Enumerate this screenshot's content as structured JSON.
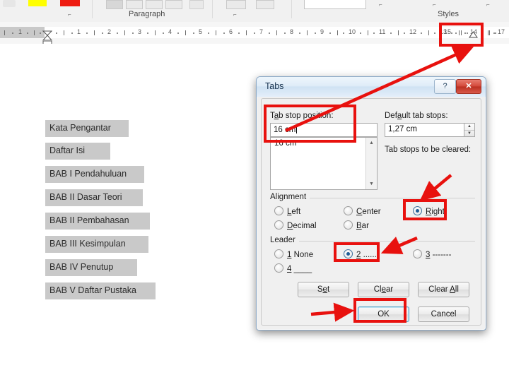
{
  "ribbon": {
    "group_paragraph_label": "Paragraph",
    "group_styles_label": "Styles",
    "dialog_launcher_glyph": "⌐",
    "swatches": [
      {
        "name": "highlight-yellow",
        "color": "#ffff00"
      },
      {
        "name": "font-color-red",
        "color": "#ee1b11"
      }
    ]
  },
  "ruler": {
    "left_ticks": [
      "1"
    ],
    "ticks": [
      "1",
      "2",
      "3",
      "4",
      "5",
      "6",
      "7",
      "8",
      "9",
      "10",
      "11",
      "12",
      "13",
      "14",
      "15",
      "17"
    ],
    "tab_stop_label": "15",
    "unit": "cm"
  },
  "document": {
    "lines": [
      "Kata Pengantar",
      "Daftar Isi",
      "BAB I Pendahuluan",
      "BAB II Dasar Teori",
      "BAB II Pembahasan",
      "BAB III Kesimpulan",
      "BAB IV Penutup",
      "BAB V Daftar Pustaka"
    ]
  },
  "dialog": {
    "title": "Tabs",
    "help_glyph": "?",
    "close_glyph": "✕",
    "tab_stop_position": {
      "label": "Tab stop position:",
      "label_pre": "T",
      "label_underlined": "a",
      "label_post": "b stop position:",
      "value": "16 cm"
    },
    "tab_stop_list": {
      "items": [
        "16 cm"
      ],
      "scroll_up_glyph": "▲",
      "scroll_down_glyph": "▼"
    },
    "default_tab_stops": {
      "label": "Default tab stops:",
      "label_pre": "Def",
      "label_underlined": "a",
      "label_post": "ult tab stops:",
      "value": "1,27 cm",
      "spin_up_glyph": "▲",
      "spin_down_glyph": "▼"
    },
    "tab_stops_to_be_cleared": {
      "label": "Tab stops to be cleared:",
      "items": []
    },
    "alignment": {
      "title": "Alignment",
      "options": [
        {
          "label": "Left",
          "pre": "",
          "u": "L",
          "post": "eft",
          "selected": false
        },
        {
          "label": "Center",
          "pre": "",
          "u": "C",
          "post": "enter",
          "selected": false
        },
        {
          "label": "Right",
          "pre": "",
          "u": "R",
          "post": "ight",
          "selected": true
        },
        {
          "label": "Decimal",
          "pre": "",
          "u": "D",
          "post": "ecimal",
          "selected": false
        },
        {
          "label": "Bar",
          "pre": "",
          "u": "B",
          "post": "ar",
          "selected": false
        }
      ],
      "selected": "Right"
    },
    "leader": {
      "title": "Leader",
      "options": [
        {
          "label": "1 None",
          "u": "1",
          "post": " None",
          "selected": false
        },
        {
          "label": "2 .......",
          "u": "2",
          "post": " .......",
          "selected": true
        },
        {
          "label": "3 -------",
          "u": "3",
          "post": " -------",
          "selected": false
        },
        {
          "label": "4 ____",
          "u": "4",
          "post": " ____",
          "selected": false
        }
      ],
      "selected": "2 ......."
    },
    "buttons": {
      "set": {
        "pre": "S",
        "u": "e",
        "post": "t"
      },
      "clear": {
        "pre": "Cl",
        "u": "e",
        "post": "ar"
      },
      "clear_all": {
        "pre": "Clear ",
        "u": "A",
        "post": "ll"
      },
      "ok": {
        "label": "OK"
      },
      "cancel": {
        "label": "Cancel"
      }
    }
  },
  "annotations": {
    "highlight_color": "#e8110e",
    "boxes": [
      {
        "name": "ruler-tabstop-highlight"
      },
      {
        "name": "tab-stop-position-highlight"
      },
      {
        "name": "alignment-right-highlight"
      },
      {
        "name": "leader-2-highlight"
      },
      {
        "name": "ok-button-highlight"
      }
    ],
    "arrows": [
      {
        "name": "arrow-to-ruler-tabstop"
      },
      {
        "name": "arrow-to-right-alignment"
      },
      {
        "name": "arrow-to-leader-2"
      },
      {
        "name": "arrow-to-ok-button"
      }
    ]
  }
}
